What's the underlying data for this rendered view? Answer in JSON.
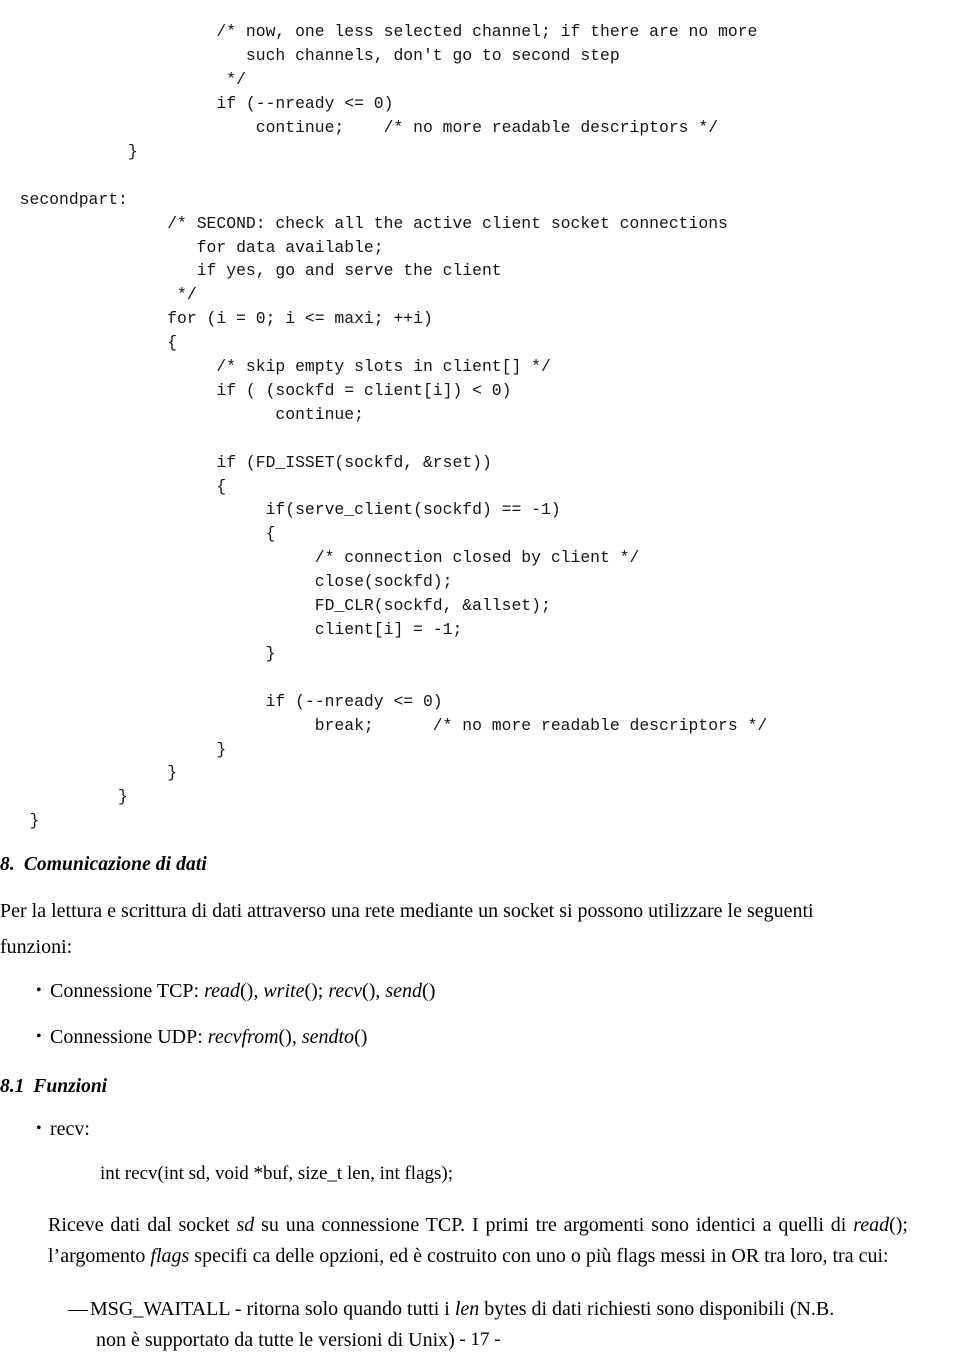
{
  "page": {
    "footer_label": "- 17 -"
  },
  "code_listing": {
    "language": "c",
    "lines": [
      "                      /* now, one less selected channel; if there are no more",
      "                         such channels, don't go to second step",
      "                       */",
      "                      if (--nready <= 0)",
      "                          continue;    /* no more readable descriptors */",
      "             }",
      "",
      "  secondpart:",
      "                 /* SECOND: check all the active client socket connections",
      "                    for data available;",
      "                    if yes, go and serve the client",
      "                  */",
      "                 for (i = 0; i <= maxi; ++i)",
      "                 {",
      "                      /* skip empty slots in client[] */",
      "                      if ( (sockfd = client[i]) < 0)",
      "                            continue;",
      "",
      "                      if (FD_ISSET(sockfd, &rset))",
      "                      {",
      "                           if(serve_client(sockfd) == -1)",
      "                           {",
      "                                /* connection closed by client */",
      "                                close(sockfd);",
      "                                FD_CLR(sockfd, &allset);",
      "                                client[i] = -1;",
      "                           }",
      "",
      "                           if (--nready <= 0)",
      "                                break;      /* no more readable descriptors */",
      "                      }",
      "                 }",
      "            }",
      "   }"
    ]
  },
  "section": {
    "number": "8.",
    "title": "Comunicazione di dati",
    "intro_line1": "Per la lettura e scrittura di dati attraverso una rete mediante un socket si possono utilizzare le seguenti",
    "intro_line2": "funzioni:",
    "bullets": [
      {
        "marker": "•",
        "lead": "Connessione TCP: ",
        "fn1": "read",
        "sep1": "(), ",
        "fn2": "write",
        "sep2": "(); ",
        "fn3": "recv",
        "sep3": "(), ",
        "fn4": "send",
        "sep4": "()"
      },
      {
        "marker": "•",
        "lead": "Connessione UDP: ",
        "fn1": "recvfrom",
        "sep1": "(), ",
        "fn2": "sendto",
        "sep2": "()",
        "fn3": "",
        "sep3": "",
        "fn4": "",
        "sep4": ""
      }
    ]
  },
  "subsection": {
    "number": "8.1",
    "title": "Funzioni",
    "bullet_marker": "•",
    "bullet_label": "recv:",
    "prototype": "int recv(int sd, void *buf, size_t len, int flags);",
    "desc_a": "Riceve dati dal socket ",
    "desc_sd": "sd",
    "desc_b": " su una connessione TCP.  I primi tre argomenti sono identici a quelli di ",
    "desc_read": "read",
    "desc_c": "(); l’argomento ",
    "desc_flags": "flags",
    "desc_d": " specifi ca delle opzioni, ed è  costruito con uno o più  flags messi in OR tra loro, tra cui:",
    "flag_items": [
      {
        "dash": "—",
        "text_a": "MSG_WAITALL - ritorna solo quando tutti i ",
        "text_it": "len",
        "text_b": " bytes di dati richiesti sono disponibili (N.B.",
        "text_cont": "non è  supportato da tutte le versioni di Unix)"
      }
    ]
  }
}
